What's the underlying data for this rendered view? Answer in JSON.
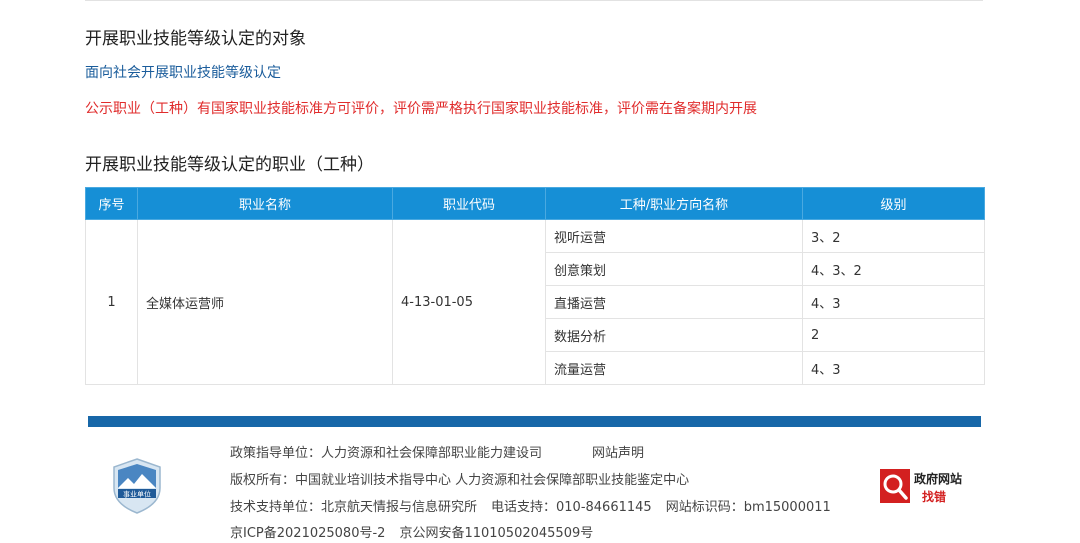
{
  "section1": {
    "title": "开展职业技能等级认定的对象",
    "scope_link": "面向社会开展职业技能等级认定",
    "notice": "公示职业（工种）有国家职业技能标准方可评价，评价需严格执行国家职业技能标准，评价需在备案期内开展"
  },
  "section2": {
    "title": "开展职业技能等级认定的职业（工种）"
  },
  "table": {
    "headers": [
      "序号",
      "职业名称",
      "职业代码",
      "工种/职业方向名称",
      "级别"
    ],
    "serial": "1",
    "occupation": "全媒体运营师",
    "code": "4-13-01-05",
    "rows": [
      {
        "direction": "视听运营",
        "level": "3、2"
      },
      {
        "direction": "创意策划",
        "level": "4、3、2"
      },
      {
        "direction": "直播运营",
        "level": "4、3"
      },
      {
        "direction": "数据分析",
        "level": "2"
      },
      {
        "direction": "流量运营",
        "level": "4、3"
      }
    ]
  },
  "footer": {
    "guidance": "政策指导单位：人力资源和社会保障部职业能力建设司",
    "statement_link": "网站声明",
    "copyright": "版权所有：中国就业培训技术指导中心  人力资源和社会保障部职业技能鉴定中心",
    "support_unit": "技术支持单位：北京航天情报与信息研究所",
    "phone": "电话支持：010-84661145",
    "site_id": "网站标识码：bm15000011",
    "icp": "京ICP备2021025080号-2",
    "police": "京公网安备11010502045509号",
    "badge_label": "事业单位",
    "gov_logo_line1": "政府网站",
    "gov_logo_line2": "找错"
  },
  "colors": {
    "table_header": "#168fd6",
    "link": "#1a5c9b",
    "notice": "#e02c2c",
    "footer_bar": "#1767a8"
  }
}
